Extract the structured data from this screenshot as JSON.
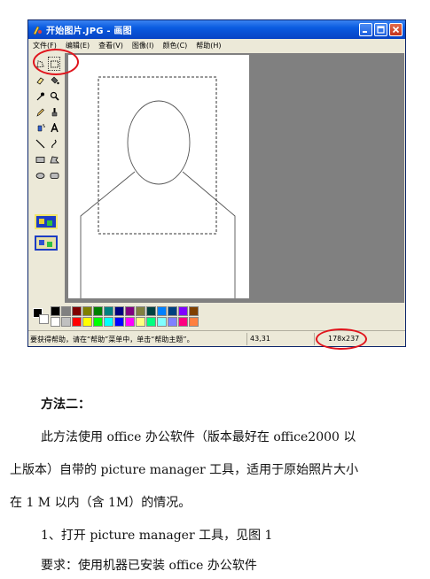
{
  "window": {
    "title": "开始图片.JPG - 画图",
    "menu": [
      "文件(F)",
      "编辑(E)",
      "查看(V)",
      "图像(I)",
      "颜色(C)",
      "帮助(H)"
    ]
  },
  "status": {
    "help": "要获得帮助，请在“帮助”菜单中，单击“帮助主题”。",
    "coords": "43,31",
    "size": "178x237"
  },
  "palette": {
    "colors": [
      "#000000",
      "#808080",
      "#800000",
      "#808000",
      "#008000",
      "#008080",
      "#000080",
      "#800080",
      "#808040",
      "#004040",
      "#0080ff",
      "#004080",
      "#8000ff",
      "#804000",
      "#ffffff",
      "#c0c0c0",
      "#ff0000",
      "#ffff00",
      "#00ff00",
      "#00ffff",
      "#0000ff",
      "#ff00ff",
      "#ffff80",
      "#00ff80",
      "#80ffff",
      "#8080ff",
      "#ff0080",
      "#ff8040"
    ]
  },
  "document": {
    "heading": "方法二：",
    "line1": "此方法使用 office 办公软件（版本最好在 office2000 以",
    "line2": "上版本）自带的 picture manager  工具，适用于原始照片大小",
    "line3": "在 1 M 以内（含 1M）的情况。",
    "line4": "1、打开 picture manager 工具，见图 1",
    "line5": "要求：使用机器已安装 office 办公软件"
  }
}
